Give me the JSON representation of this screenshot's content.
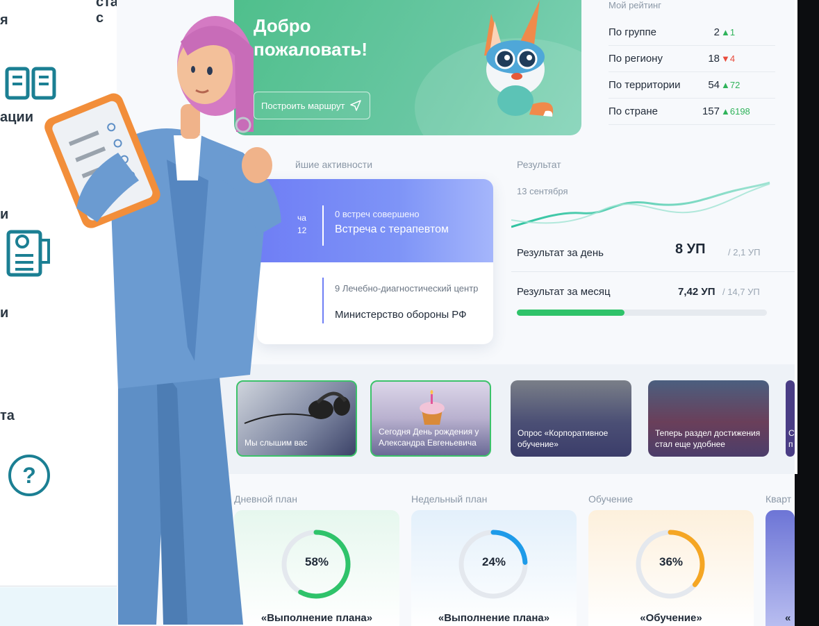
{
  "sidebar": {
    "frag_top": "ставителей с",
    "frag_top2": "я",
    "frag_1": "ации",
    "frag_2": "и",
    "frag_3": "и",
    "frag_4": "та",
    "help": "?"
  },
  "welcome": {
    "title": "Добро пожаловать!",
    "route_button": "Построить маршрут"
  },
  "rating": {
    "title": "Мой рейтинг",
    "rows": [
      {
        "label": "По группе",
        "value": "2",
        "delta": "▲1",
        "dir": "up"
      },
      {
        "label": "По региону",
        "value": "18",
        "delta": "▼4",
        "dir": "down"
      },
      {
        "label": "По территории",
        "value": "54",
        "delta": "▲72",
        "dir": "up"
      },
      {
        "label": "По стране",
        "value": "157",
        "delta": "▲6198",
        "dir": "up"
      }
    ]
  },
  "activities": {
    "title": "йшие активности",
    "item1": {
      "date_line1": "ча",
      "date_line2": "12",
      "sub": "0 встреч совершено",
      "main": "Встреча с терапевтом"
    },
    "item2": {
      "sub": "9 Лечебно-диагностический центр",
      "main": "Министерство обороны РФ"
    }
  },
  "result": {
    "title": "Результат",
    "date": "13 сентября",
    "day_label": "Результат за день",
    "day_value": "8 УП",
    "day_of": "/ 2,1 УП",
    "month_label": "Результат за месяц",
    "month_value": "7,42 УП",
    "month_of": "/ 14,7 УП",
    "month_progress": 0.43
  },
  "news": [
    {
      "text": "Мы слышим вас",
      "active": true
    },
    {
      "text": "Сегодня День рождения у Александра Евгеньевича",
      "active": true
    },
    {
      "text": "Опрос «Корпоративное обучение»",
      "active": false
    },
    {
      "text": "Теперь раздел достижения стал еще удобнее",
      "active": false
    },
    {
      "text": "С п",
      "active": false
    }
  ],
  "plans": [
    {
      "label": "Дневной план",
      "pct": "58%",
      "value": 0.58,
      "name": "«Выполнение плана»",
      "color": "#2fc36a"
    },
    {
      "label": "Недельный план",
      "pct": "24%",
      "value": 0.24,
      "name": "«Выполнение плана»",
      "color": "#1e9be9"
    },
    {
      "label": "Обучение",
      "pct": "36%",
      "value": 0.36,
      "name": "«Обучение»",
      "color": "#f5a623"
    },
    {
      "label": "Кварт",
      "pct": "",
      "value": 0,
      "name": "«",
      "color": "#6f7ef5"
    }
  ],
  "colors": {
    "accent_teal": "#1b7f93",
    "green": "#2fc36a"
  }
}
